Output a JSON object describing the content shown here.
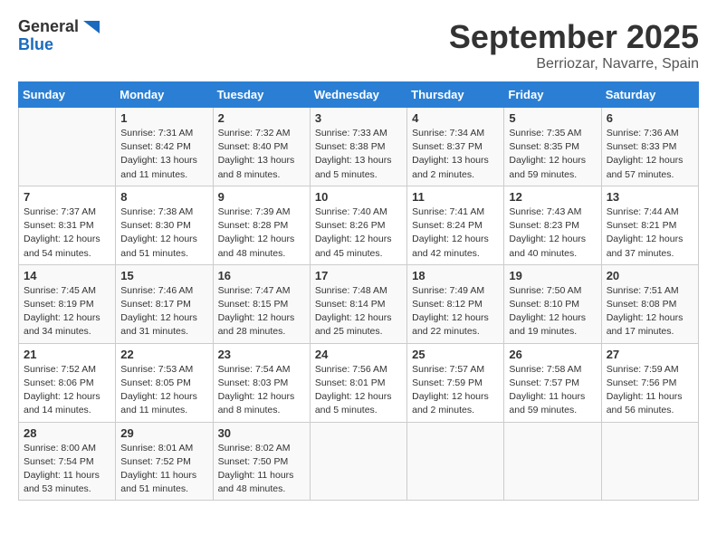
{
  "logo": {
    "line1": "General",
    "line2": "Blue"
  },
  "title": "September 2025",
  "location": "Berriozar, Navarre, Spain",
  "header": {
    "days": [
      "Sunday",
      "Monday",
      "Tuesday",
      "Wednesday",
      "Thursday",
      "Friday",
      "Saturday"
    ]
  },
  "weeks": [
    [
      {
        "day": "",
        "content": ""
      },
      {
        "day": "1",
        "content": "Sunrise: 7:31 AM\nSunset: 8:42 PM\nDaylight: 13 hours\nand 11 minutes."
      },
      {
        "day": "2",
        "content": "Sunrise: 7:32 AM\nSunset: 8:40 PM\nDaylight: 13 hours\nand 8 minutes."
      },
      {
        "day": "3",
        "content": "Sunrise: 7:33 AM\nSunset: 8:38 PM\nDaylight: 13 hours\nand 5 minutes."
      },
      {
        "day": "4",
        "content": "Sunrise: 7:34 AM\nSunset: 8:37 PM\nDaylight: 13 hours\nand 2 minutes."
      },
      {
        "day": "5",
        "content": "Sunrise: 7:35 AM\nSunset: 8:35 PM\nDaylight: 12 hours\nand 59 minutes."
      },
      {
        "day": "6",
        "content": "Sunrise: 7:36 AM\nSunset: 8:33 PM\nDaylight: 12 hours\nand 57 minutes."
      }
    ],
    [
      {
        "day": "7",
        "content": "Sunrise: 7:37 AM\nSunset: 8:31 PM\nDaylight: 12 hours\nand 54 minutes."
      },
      {
        "day": "8",
        "content": "Sunrise: 7:38 AM\nSunset: 8:30 PM\nDaylight: 12 hours\nand 51 minutes."
      },
      {
        "day": "9",
        "content": "Sunrise: 7:39 AM\nSunset: 8:28 PM\nDaylight: 12 hours\nand 48 minutes."
      },
      {
        "day": "10",
        "content": "Sunrise: 7:40 AM\nSunset: 8:26 PM\nDaylight: 12 hours\nand 45 minutes."
      },
      {
        "day": "11",
        "content": "Sunrise: 7:41 AM\nSunset: 8:24 PM\nDaylight: 12 hours\nand 42 minutes."
      },
      {
        "day": "12",
        "content": "Sunrise: 7:43 AM\nSunset: 8:23 PM\nDaylight: 12 hours\nand 40 minutes."
      },
      {
        "day": "13",
        "content": "Sunrise: 7:44 AM\nSunset: 8:21 PM\nDaylight: 12 hours\nand 37 minutes."
      }
    ],
    [
      {
        "day": "14",
        "content": "Sunrise: 7:45 AM\nSunset: 8:19 PM\nDaylight: 12 hours\nand 34 minutes."
      },
      {
        "day": "15",
        "content": "Sunrise: 7:46 AM\nSunset: 8:17 PM\nDaylight: 12 hours\nand 31 minutes."
      },
      {
        "day": "16",
        "content": "Sunrise: 7:47 AM\nSunset: 8:15 PM\nDaylight: 12 hours\nand 28 minutes."
      },
      {
        "day": "17",
        "content": "Sunrise: 7:48 AM\nSunset: 8:14 PM\nDaylight: 12 hours\nand 25 minutes."
      },
      {
        "day": "18",
        "content": "Sunrise: 7:49 AM\nSunset: 8:12 PM\nDaylight: 12 hours\nand 22 minutes."
      },
      {
        "day": "19",
        "content": "Sunrise: 7:50 AM\nSunset: 8:10 PM\nDaylight: 12 hours\nand 19 minutes."
      },
      {
        "day": "20",
        "content": "Sunrise: 7:51 AM\nSunset: 8:08 PM\nDaylight: 12 hours\nand 17 minutes."
      }
    ],
    [
      {
        "day": "21",
        "content": "Sunrise: 7:52 AM\nSunset: 8:06 PM\nDaylight: 12 hours\nand 14 minutes."
      },
      {
        "day": "22",
        "content": "Sunrise: 7:53 AM\nSunset: 8:05 PM\nDaylight: 12 hours\nand 11 minutes."
      },
      {
        "day": "23",
        "content": "Sunrise: 7:54 AM\nSunset: 8:03 PM\nDaylight: 12 hours\nand 8 minutes."
      },
      {
        "day": "24",
        "content": "Sunrise: 7:56 AM\nSunset: 8:01 PM\nDaylight: 12 hours\nand 5 minutes."
      },
      {
        "day": "25",
        "content": "Sunrise: 7:57 AM\nSunset: 7:59 PM\nDaylight: 12 hours\nand 2 minutes."
      },
      {
        "day": "26",
        "content": "Sunrise: 7:58 AM\nSunset: 7:57 PM\nDaylight: 11 hours\nand 59 minutes."
      },
      {
        "day": "27",
        "content": "Sunrise: 7:59 AM\nSunset: 7:56 PM\nDaylight: 11 hours\nand 56 minutes."
      }
    ],
    [
      {
        "day": "28",
        "content": "Sunrise: 8:00 AM\nSunset: 7:54 PM\nDaylight: 11 hours\nand 53 minutes."
      },
      {
        "day": "29",
        "content": "Sunrise: 8:01 AM\nSunset: 7:52 PM\nDaylight: 11 hours\nand 51 minutes."
      },
      {
        "day": "30",
        "content": "Sunrise: 8:02 AM\nSunset: 7:50 PM\nDaylight: 11 hours\nand 48 minutes."
      },
      {
        "day": "",
        "content": ""
      },
      {
        "day": "",
        "content": ""
      },
      {
        "day": "",
        "content": ""
      },
      {
        "day": "",
        "content": ""
      }
    ]
  ]
}
